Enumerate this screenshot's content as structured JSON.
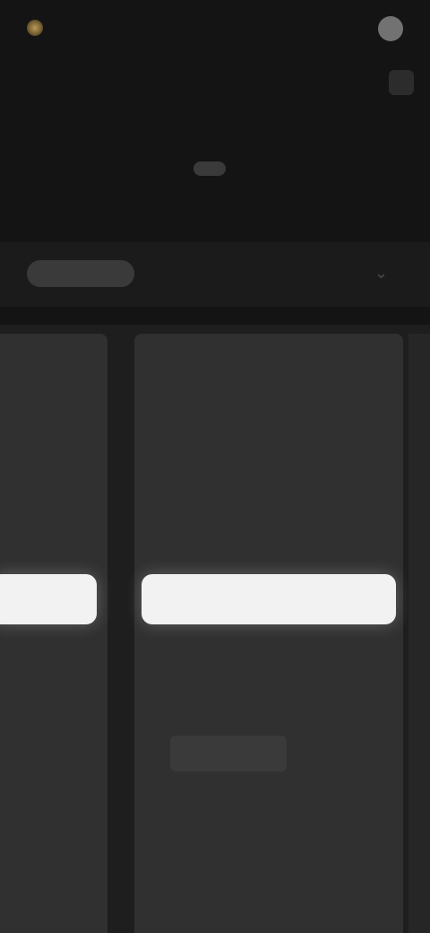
{
  "header": {
    "logo_text": "",
    "nav_link": "",
    "icons": [
      "logo-icon",
      "avatar-icon",
      "menu-icon"
    ]
  },
  "hero": {
    "title": "",
    "toggle_active": "",
    "toggle_inactive": ""
  },
  "filters": {
    "chip_label": "",
    "hint": "",
    "icon": "chevron-down-icon"
  },
  "plans": [
    {
      "name": "",
      "description": "",
      "price": "",
      "price_note": "",
      "cta_label": "",
      "features": [
        "",
        ""
      ]
    },
    {
      "name": "",
      "description": "",
      "price": "",
      "price_note": "",
      "cta_label": "",
      "features": [
        "",
        "",
        ""
      ]
    }
  ],
  "colors": {
    "background": "#141414",
    "card": "#303030",
    "cta": "#f2f2f2",
    "accent": "#b99a58"
  }
}
